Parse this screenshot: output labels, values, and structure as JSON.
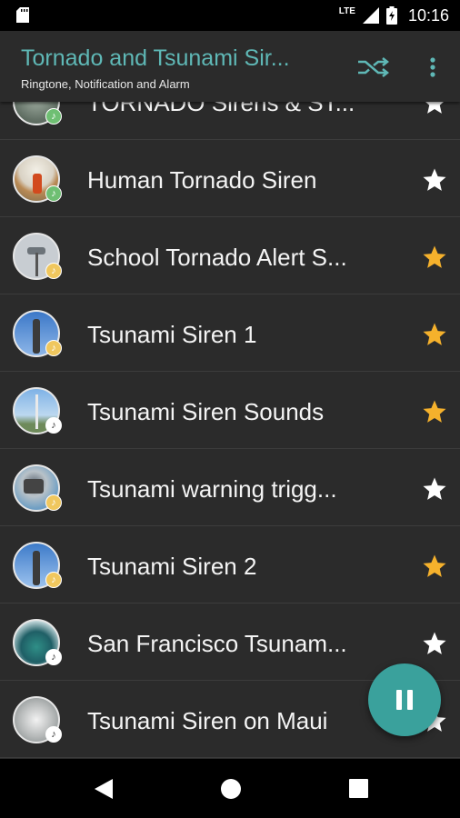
{
  "status_bar": {
    "network": "LTE",
    "time": "10:16",
    "icons": [
      "sd-card-icon",
      "signal-icon",
      "battery-charging-icon"
    ]
  },
  "app_bar": {
    "title": "Tornado and Tsunami Sir...",
    "subtitle": "Ringtone, Notification and Alarm",
    "actions": [
      "shuffle-icon",
      "more-vert-icon"
    ],
    "accent_color": "#5fb8b6"
  },
  "list": {
    "items": [
      {
        "title": "TORNADO Sirens & ST...",
        "favorite": false,
        "badge_color": "#6fbf73"
      },
      {
        "title": "Human Tornado Siren",
        "favorite": false,
        "badge_color": "#6fbf73"
      },
      {
        "title": "School Tornado Alert S...",
        "favorite": true,
        "badge_color": "#f0c75e"
      },
      {
        "title": "Tsunami Siren 1",
        "favorite": true,
        "badge_color": "#f0c75e"
      },
      {
        "title": "Tsunami Siren Sounds",
        "favorite": true,
        "badge_color": "#ffffff"
      },
      {
        "title": "Tsunami warning trigg...",
        "favorite": false,
        "badge_color": "#f0c75e"
      },
      {
        "title": "Tsunami Siren 2",
        "favorite": true,
        "badge_color": "#f0c75e"
      },
      {
        "title": "San Francisco Tsunam...",
        "favorite": false,
        "badge_color": "#ffffff"
      },
      {
        "title": "Tsunami Siren on Maui",
        "favorite": false,
        "badge_color": "#ffffff"
      }
    ],
    "star_on_color": "#f5b12c",
    "star_off_color": "#ffffff"
  },
  "fab": {
    "icon": "pause-icon",
    "color": "#3aa19c"
  },
  "nav_bar": {
    "buttons": [
      "back-icon",
      "home-icon",
      "recents-icon"
    ]
  }
}
